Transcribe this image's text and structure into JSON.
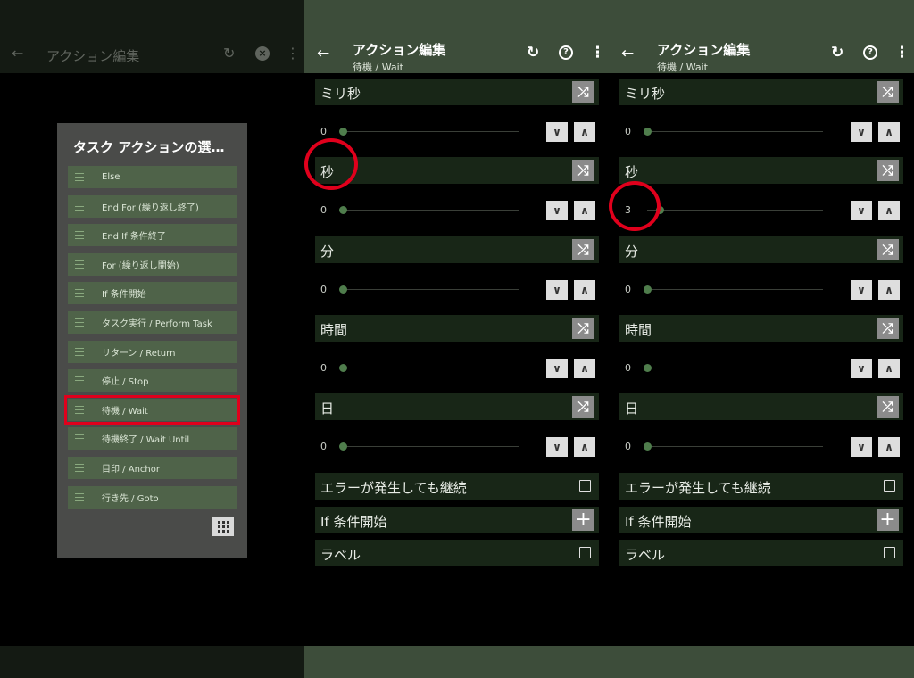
{
  "panel1": {
    "title": "アクション編集",
    "dialog": {
      "title": "タスク アクションの選…",
      "items": [
        "Else",
        "End For (繰り返し終了)",
        "End If 条件終了",
        "For (繰り返し開始)",
        "If 条件開始",
        "タスク実行 / Perform Task",
        "リターン / Return",
        "停止 / Stop",
        "待機 / Wait",
        "待機終了 / Wait Until",
        "目印 / Anchor",
        "行き先 / Goto"
      ],
      "selected_index": 8
    }
  },
  "panel2": {
    "title": "アクション編集",
    "subtitle": "待機 / Wait",
    "fields": [
      {
        "label": "ミリ秒",
        "value": "0"
      },
      {
        "label": "秒",
        "value": "0"
      },
      {
        "label": "分",
        "value": "0"
      },
      {
        "label": "時間",
        "value": "0"
      },
      {
        "label": "日",
        "value": "0"
      }
    ],
    "options": {
      "continue_on_error": "エラーが発生しても継続",
      "if_start": "If 条件開始",
      "label": "ラベル"
    }
  },
  "panel3": {
    "title": "アクション編集",
    "subtitle": "待機 / Wait",
    "fields": [
      {
        "label": "ミリ秒",
        "value": "0"
      },
      {
        "label": "秒",
        "value": "3"
      },
      {
        "label": "分",
        "value": "0"
      },
      {
        "label": "時間",
        "value": "0"
      },
      {
        "label": "日",
        "value": "0"
      }
    ],
    "options": {
      "continue_on_error": "エラーが発生しても継続",
      "if_start": "If 条件開始",
      "label": "ラベル"
    }
  },
  "colors": {
    "appbar": "#3d4d3a",
    "field_bg": "#182617",
    "highlight": "#e0001c",
    "list_item": "#4f6349"
  },
  "icons": [
    "back-arrow-icon",
    "undo-icon",
    "close-icon",
    "help-icon",
    "more-vert-icon",
    "shuffle-icon",
    "chevron-down-icon",
    "chevron-up-icon",
    "checkbox-icon",
    "plus-icon",
    "grid-icon",
    "list-icon"
  ]
}
